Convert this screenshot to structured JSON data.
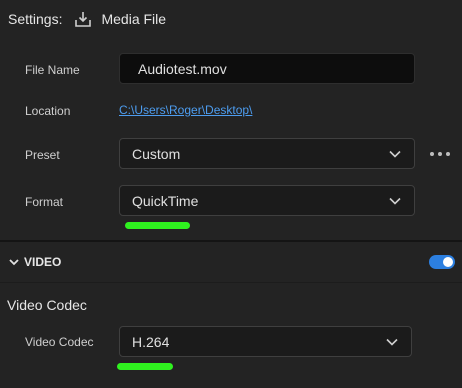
{
  "header": {
    "settings_label": "Settings:",
    "export_icon": "export-download-icon",
    "media_label": "Media File"
  },
  "file_name": {
    "label": "File Name",
    "value": "Audiotest.mov"
  },
  "location": {
    "label": "Location",
    "path": "C:\\Users\\Roger\\Desktop\\"
  },
  "preset": {
    "label": "Preset",
    "value": "Custom",
    "more_icon": "more-options-icon"
  },
  "format": {
    "label": "Format",
    "value": "QuickTime"
  },
  "video_section": {
    "title": "VIDEO",
    "enabled": true,
    "sub_heading": "Video Codec",
    "codec_label": "Video Codec",
    "codec_value": "H.264"
  },
  "colors": {
    "background": "#232323",
    "link": "#4d9df0",
    "toggle_on": "#2c7fe0",
    "annotation": "#2ff21f"
  }
}
